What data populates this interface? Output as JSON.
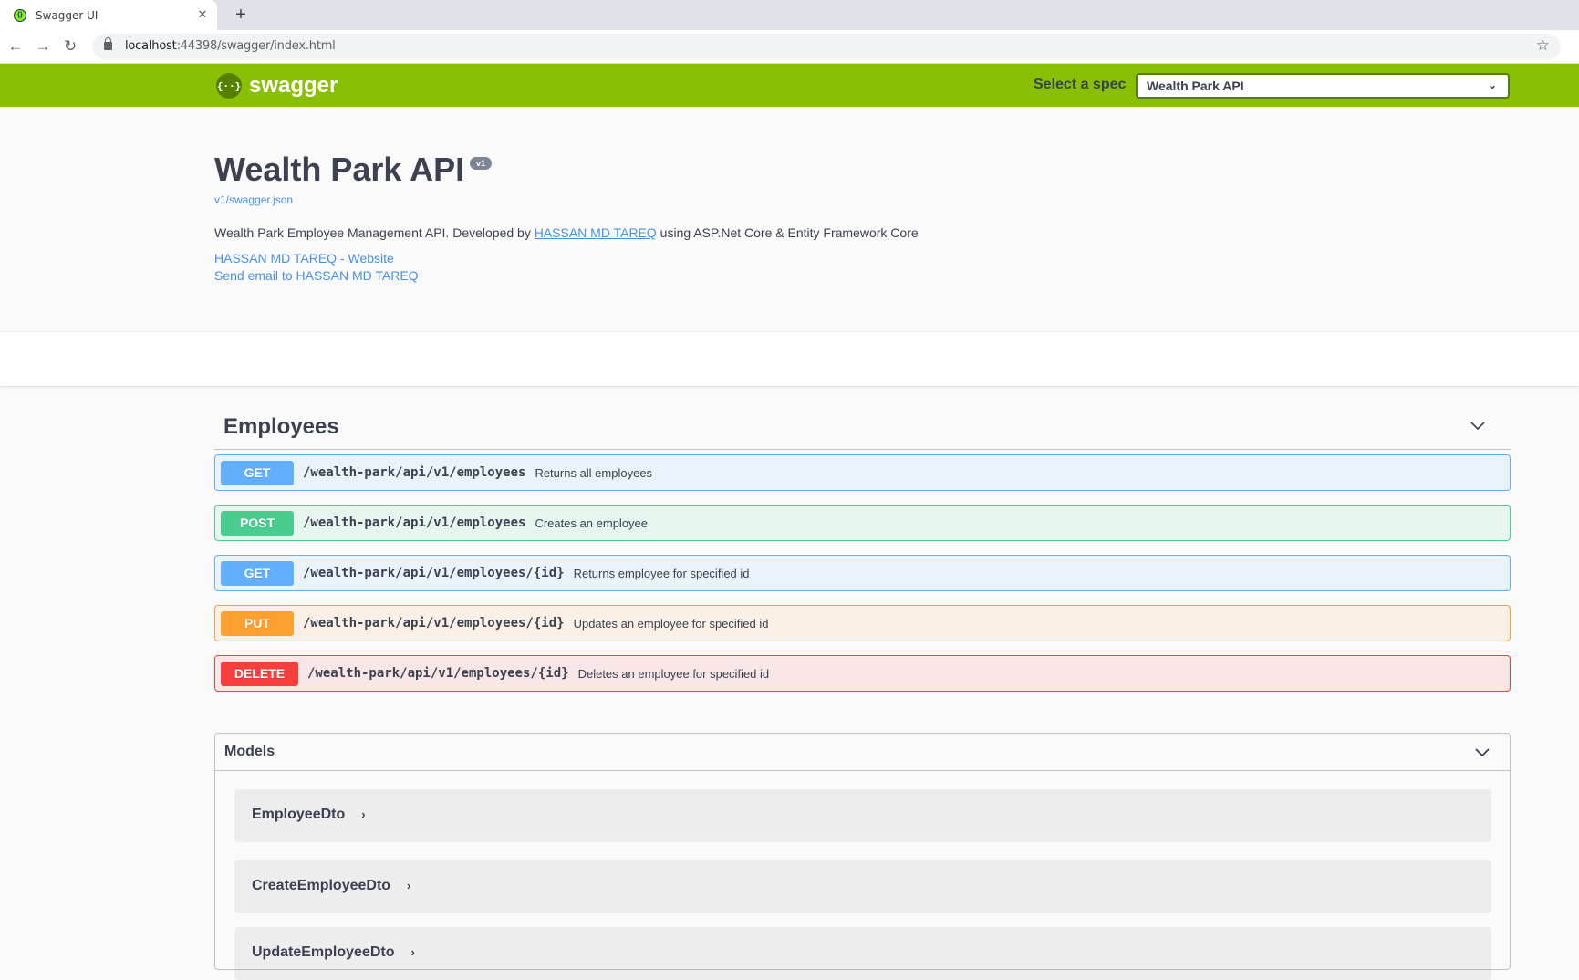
{
  "browser": {
    "tab_title": "Swagger UI",
    "tab_close": "✕",
    "new_tab": "+",
    "url_host": "localhost",
    "url_path": ":44398/swagger/index.html"
  },
  "topbar": {
    "logo_text": "swagger",
    "logo_glyph": "{··}",
    "spec_label": "Select a spec",
    "spec_selected": "Wealth Park API"
  },
  "info": {
    "title": "Wealth Park API",
    "version": "v1",
    "spec_link": "v1/swagger.json",
    "description_prefix": "Wealth Park Employee Management API. Developed by ",
    "description_link": "HASSAN MD TAREQ",
    "description_suffix": " using ASP.Net Core & Entity Framework Core",
    "website_link": "HASSAN MD TAREQ - Website",
    "email_link": "Send email to HASSAN MD TAREQ"
  },
  "tag": {
    "name": "Employees",
    "operations": [
      {
        "method": "GET",
        "path": "/wealth-park/api/v1/employees",
        "summary": "Returns all employees"
      },
      {
        "method": "POST",
        "path": "/wealth-park/api/v1/employees",
        "summary": "Creates an employee"
      },
      {
        "method": "GET",
        "path": "/wealth-park/api/v1/employees/{id}",
        "summary": "Returns employee for specified id"
      },
      {
        "method": "PUT",
        "path": "/wealth-park/api/v1/employees/{id}",
        "summary": "Updates an employee for specified id"
      },
      {
        "method": "DELETE",
        "path": "/wealth-park/api/v1/employees/{id}",
        "summary": "Deletes an employee for specified id"
      }
    ]
  },
  "models": {
    "title": "Models",
    "items": [
      "EmployeeDto",
      "CreateEmployeeDto",
      "UpdateEmployeeDto"
    ]
  },
  "colors": {
    "topbar": "#89bf04",
    "get": "#61affe",
    "post": "#49cc90",
    "put": "#fca130",
    "delete": "#f93e3e",
    "link": "#4990e2"
  }
}
